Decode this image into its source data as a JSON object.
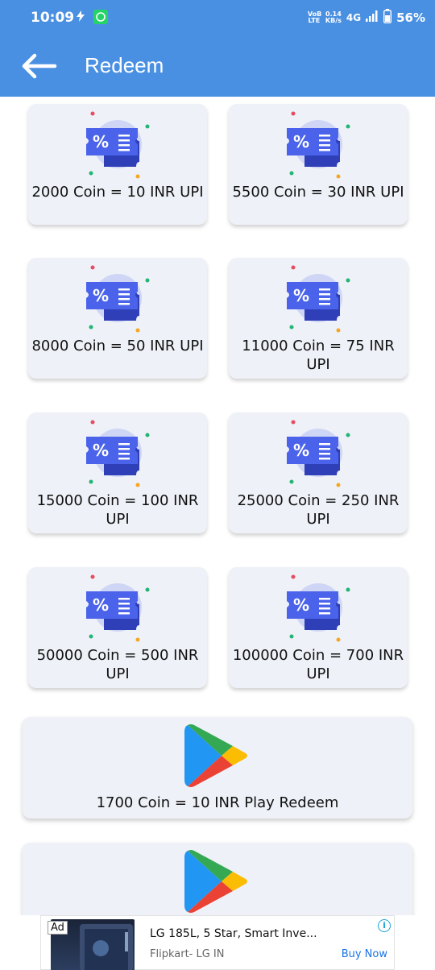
{
  "status_bar": {
    "time": "10:09",
    "volte": "VoB LTE",
    "speed_value": "0.14",
    "speed_unit": "KB/s",
    "network": "4G",
    "battery": "56%"
  },
  "header": {
    "title": "Redeem"
  },
  "rewards": [
    {
      "label": "2000 Coin = 10 INR UPI"
    },
    {
      "label": "5500 Coin = 30 INR UPI"
    },
    {
      "label": "8000 Coin = 50 INR UPI"
    },
    {
      "label": "11000 Coin = 75 INR UPI"
    },
    {
      "label": "15000 Coin = 100 INR UPI"
    },
    {
      "label": "25000 Coin = 250 INR UPI"
    },
    {
      "label": "50000 Coin = 500 INR UPI"
    },
    {
      "label": "100000 Coin = 700 INR UPI"
    }
  ],
  "play_rewards": [
    {
      "label": "1700 Coin = 10 INR Play Redeem"
    },
    {
      "label": ""
    }
  ],
  "ad": {
    "tag": "Ad",
    "headline": "LG 185L, 5 Star, Smart Inve...",
    "advertiser": "Flipkart- LG IN",
    "cta": "Buy Now"
  },
  "colors": {
    "primary": "#4a90e2",
    "card": "#eef1f7",
    "coupon": "#3d5ae0"
  }
}
